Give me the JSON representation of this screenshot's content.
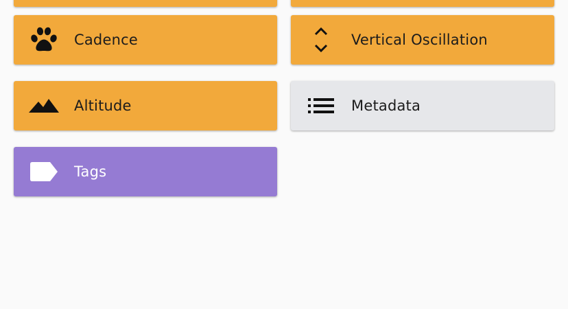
{
  "colors": {
    "background": "#fafafa",
    "orange": "#f2a93b",
    "grey": "#e6e7ea",
    "purple": "#957bd3"
  },
  "cards": [
    {
      "label": "Cadence",
      "icon": "paw-icon"
    },
    {
      "label": "Vertical Oscillation",
      "icon": "vertical-arrows-icon"
    },
    {
      "label": "Altitude",
      "icon": "mountains-icon"
    },
    {
      "label": "Metadata",
      "icon": "list-icon"
    },
    {
      "label": "Tags",
      "icon": "tag-icon"
    }
  ]
}
